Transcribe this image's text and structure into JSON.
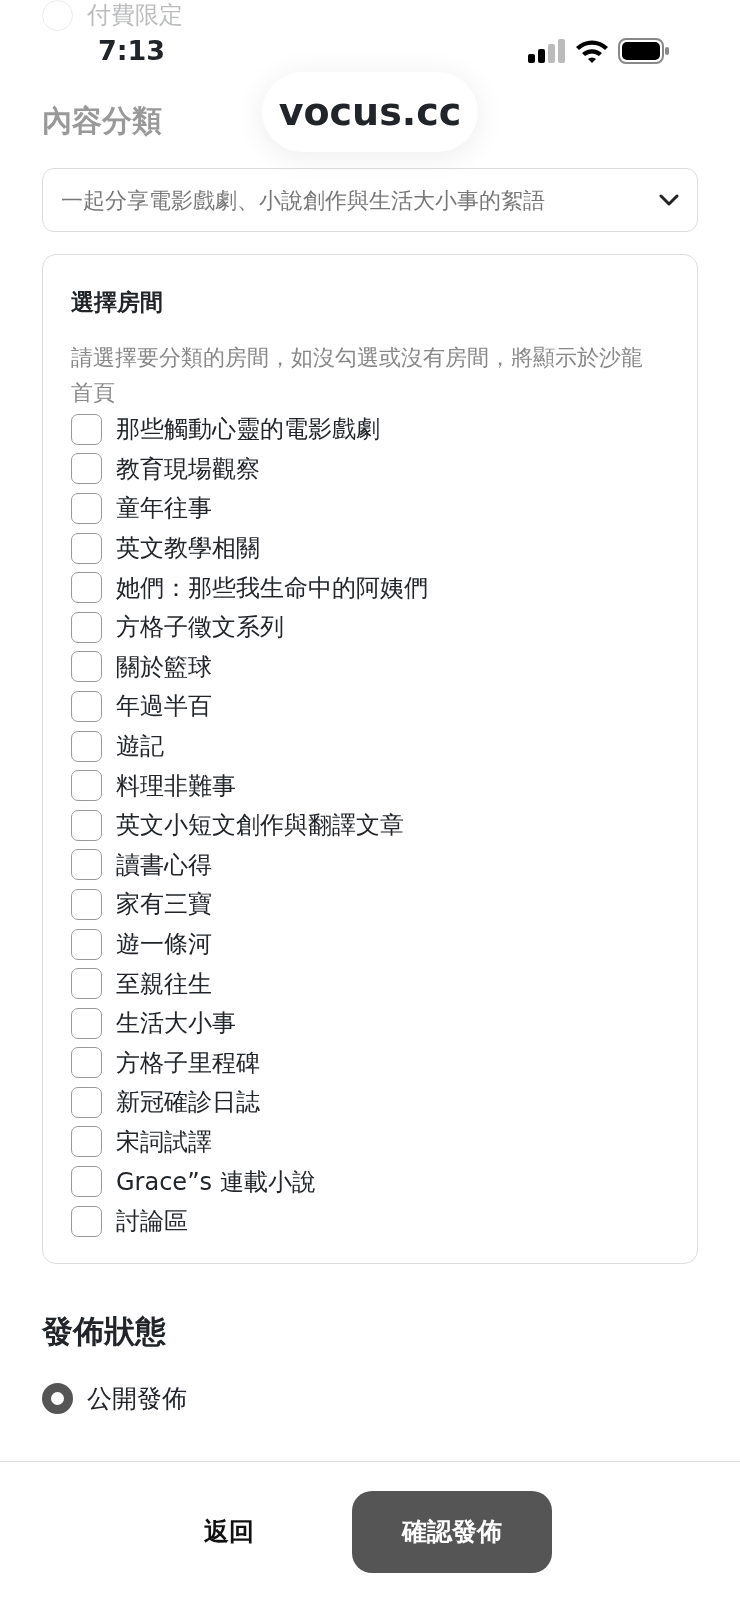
{
  "status_bar": {
    "time": "7:13"
  },
  "top_option": {
    "label": "付費限定",
    "selected": false
  },
  "url_pill": "vocus.cc",
  "category": {
    "title": "內容分類",
    "value": "一起分享電影戲劇、小說創作與生活大小事的絮語"
  },
  "rooms": {
    "title": "選擇房間",
    "hint": "請選擇要分類的房間，如沒勾選或沒有房間，將顯示於沙龍首頁",
    "items": [
      {
        "label": "那些觸動心靈的電影戲劇",
        "checked": false
      },
      {
        "label": "教育現場觀察",
        "checked": false
      },
      {
        "label": "童年往事",
        "checked": false
      },
      {
        "label": "英文教學相關",
        "checked": false
      },
      {
        "label": "她們：那些我生命中的阿姨們",
        "checked": false
      },
      {
        "label": "方格子徵文系列",
        "checked": false
      },
      {
        "label": "關於籃球",
        "checked": false
      },
      {
        "label": "年過半百",
        "checked": false
      },
      {
        "label": "遊記",
        "checked": false
      },
      {
        "label": "料理非難事",
        "checked": false
      },
      {
        "label": "英文小短文創作與翻譯文章",
        "checked": false
      },
      {
        "label": "讀書心得",
        "checked": false
      },
      {
        "label": "家有三寶",
        "checked": false
      },
      {
        "label": "遊一條河",
        "checked": false
      },
      {
        "label": "至親往生",
        "checked": false
      },
      {
        "label": "生活大小事",
        "checked": false
      },
      {
        "label": "方格子里程碑",
        "checked": false
      },
      {
        "label": "新冠確診日誌",
        "checked": false
      },
      {
        "label": "宋詞試譯",
        "checked": false
      },
      {
        "label": "Grace”s 連載小說",
        "checked": false
      },
      {
        "label": "討論區",
        "checked": false
      }
    ]
  },
  "publish_status": {
    "title": "發佈狀態",
    "options": [
      {
        "label": "公開發佈",
        "selected": true
      }
    ]
  },
  "footer": {
    "back": "返回",
    "confirm": "確認發佈"
  }
}
